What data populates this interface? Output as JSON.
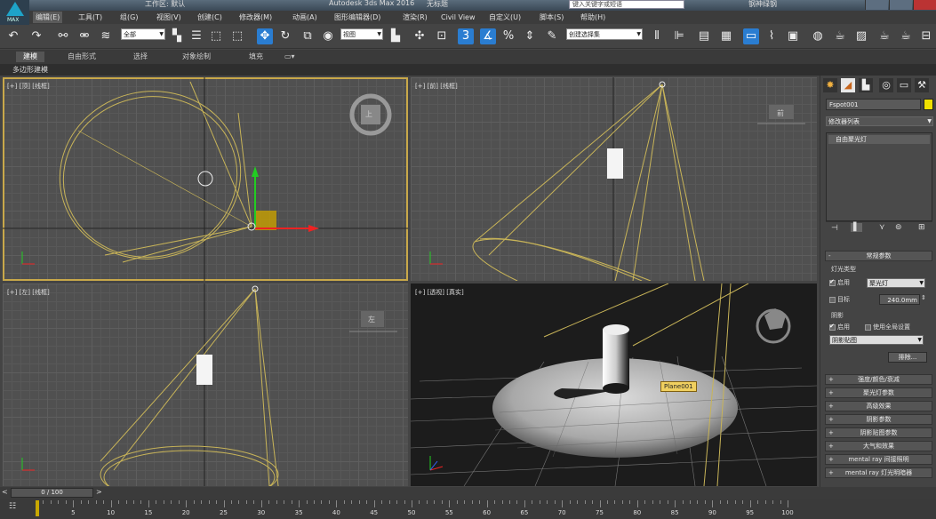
{
  "titlebar": {
    "workspace_label": "工作区: 默认",
    "app_title": "Autodesk 3ds Max 2016",
    "doc_title": "无标题",
    "search_placeholder": "键入关键字或短语",
    "user_label": "钢神绿钢"
  },
  "menubar": {
    "items": [
      "编辑(E)",
      "工具(T)",
      "组(G)",
      "视图(V)",
      "创建(C)",
      "修改器(M)",
      "动画(A)",
      "图形编辑器(D)",
      "渲染(R)",
      "Civil View",
      "自定义(U)",
      "脚本(S)",
      "帮助(H)"
    ]
  },
  "toolbar": {
    "selection_filter": "全部",
    "ref_coord": "视图",
    "named_selection": "创建选择集"
  },
  "ribbon": {
    "tabs": [
      "建模",
      "自由形式",
      "选择",
      "对象绘制",
      "填充"
    ],
    "subpanel": "多边形建模"
  },
  "viewports": {
    "top": {
      "label": "[+] [顶] [线框]",
      "cube": "上"
    },
    "front": {
      "label": "[+] [前] [线框]",
      "cube": "前"
    },
    "left": {
      "label": "[+] [左] [线框]",
      "cube": "左"
    },
    "persp": {
      "label": "[+] [透视] [真实]",
      "tooltip": "Plane001"
    }
  },
  "command_panel": {
    "object_name": "Fspot001",
    "modifier_list": "修改器列表",
    "stack_item": "自由聚光灯",
    "rollout_general": "常规参数",
    "light_type_label": "灯光类型",
    "enable_label": "启用",
    "light_type_value": "聚光灯",
    "target_label": "目标",
    "target_distance": "240.0mm",
    "shadows_label": "阴影",
    "shadow_enable": "启用",
    "use_global": "使用全局设置",
    "shadow_type": "阴影贴图",
    "exclude_button": "排除...",
    "rollouts": [
      "强度/颜色/衰减",
      "聚光灯参数",
      "高级效果",
      "阴影参数",
      "阴影贴图参数",
      "大气和效果",
      "mental ray 间接照明",
      "mental ray 灯光明暗器"
    ]
  },
  "timeline": {
    "slider": "0 / 100",
    "ticks": [
      "5",
      "10",
      "15",
      "20",
      "25",
      "30",
      "35",
      "40",
      "45",
      "50",
      "55",
      "60",
      "65",
      "70",
      "75",
      "80",
      "85",
      "90",
      "95",
      "100"
    ]
  },
  "colors": {
    "accent": "#2a7dd1",
    "active_viewport": "#c8a84a",
    "light_wire": "#c8b458"
  }
}
